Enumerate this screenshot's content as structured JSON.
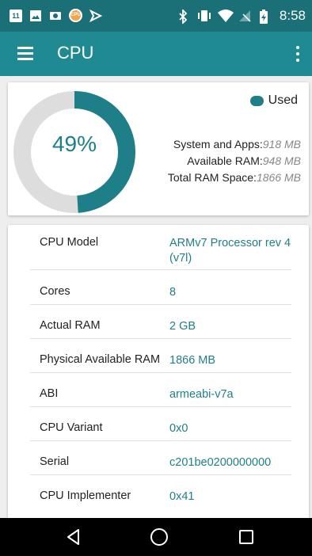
{
  "status_bar": {
    "time": "8:58",
    "left_icons": [
      "calendar-icon",
      "image-icon",
      "email-icon",
      "cpu-app-icon",
      "send-icon"
    ],
    "right_icons": [
      "bluetooth-icon",
      "vibrate-icon",
      "wifi-icon",
      "no-signal-icon",
      "battery-charging-icon"
    ],
    "calendar_day": "11",
    "cpu_badge": "CPU"
  },
  "app_bar": {
    "title": "CPU",
    "menu_icon": "menu-icon",
    "overflow_icon": "more-vert-icon"
  },
  "memory": {
    "used_percent_label": "49%",
    "used_fraction": 0.49,
    "legend_label": "Used",
    "rows": [
      {
        "label": "System and Apps:",
        "value": "918 MB"
      },
      {
        "label": "Available RAM:",
        "value": "948 MB"
      },
      {
        "label": "Total RAM Space:",
        "value": "1866 MB"
      }
    ],
    "colors": {
      "used": "#1f7f88",
      "free": "#dddddd"
    }
  },
  "cpu_info": [
    {
      "label": "CPU Model",
      "value": "ARMv7 Processor rev 4 (v7l)"
    },
    {
      "label": "Cores",
      "value": "8"
    },
    {
      "label": "Actual RAM",
      "value": "2 GB"
    },
    {
      "label": "Physical Available RAM",
      "value": "1866 MB"
    },
    {
      "label": "ABI",
      "value": "armeabi-v7a"
    },
    {
      "label": "CPU Variant",
      "value": "0x0"
    },
    {
      "label": "Serial",
      "value": "c201be0200000000"
    },
    {
      "label": "CPU Implementer",
      "value": "0x41"
    }
  ],
  "nav_bar": {
    "back_icon": "back-icon",
    "home_icon": "home-icon",
    "recents_icon": "recents-icon"
  },
  "theme": {
    "status_bar": "#1b6f76",
    "app_bar": "#1f8a92",
    "accent": "#1f7f88",
    "background": "#eeeeee"
  }
}
